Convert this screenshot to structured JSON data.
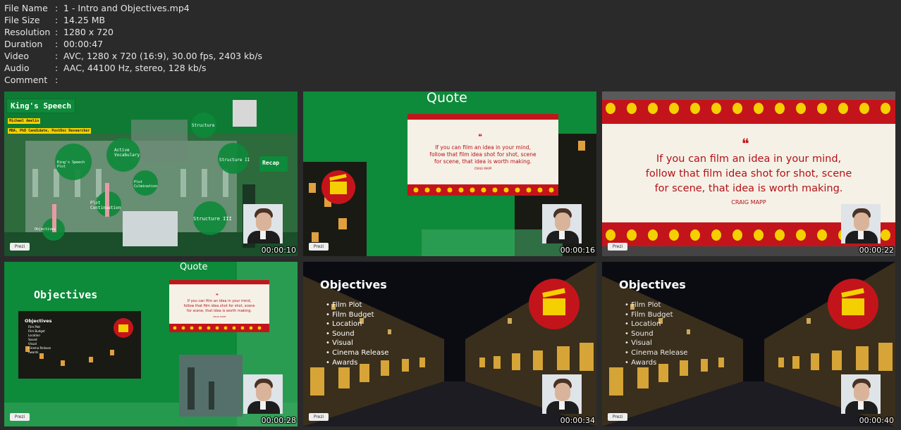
{
  "file_info": [
    {
      "key": "File Name",
      "value": "1 - Intro and Objectives.mp4"
    },
    {
      "key": "File Size",
      "value": "14.25 MB"
    },
    {
      "key": "Resolution",
      "value": "1280 x 720"
    },
    {
      "key": "Duration",
      "value": "00:00:47"
    },
    {
      "key": "Video",
      "value": "AVC, 1280 x 720 (16:9), 30.00 fps, 2403 kb/s"
    },
    {
      "key": "Audio",
      "value": "AAC, 44100 Hz, stereo, 128 kb/s"
    },
    {
      "key": "Comment",
      "value": ""
    }
  ],
  "separator": ":",
  "thumbnails": [
    {
      "timestamp": "00:00:10"
    },
    {
      "timestamp": "00:00:16"
    },
    {
      "timestamp": "00:00:22"
    },
    {
      "timestamp": "00:00:28"
    },
    {
      "timestamp": "00:00:34"
    },
    {
      "timestamp": "00:00:40"
    }
  ],
  "slide1": {
    "title": "King's Speech",
    "author": "Michael Amelin",
    "credentials": "MBA, PhD Candidate, PostDoc Researcher",
    "nodes": [
      "Structure",
      "Active Vocabulary",
      "King's Speech Plot",
      "Structure II",
      "Recap",
      "Plot Culmination",
      "Plot Continuation",
      "Structure III",
      "Objectives"
    ]
  },
  "quote": {
    "heading": "Quote",
    "mark": "❝",
    "line1": "If you can film an idea in your mind,",
    "line2": "follow that film idea shot for shot, scene",
    "line3": "for scene, that idea is worth making.",
    "author": "CRAIG MAPP"
  },
  "objectives": {
    "title": "Objectives",
    "items": [
      "Film Plot",
      "Film Budget",
      "Location",
      "Sound",
      "Visual",
      "Cinema Release",
      "Awards"
    ]
  },
  "prezi_label": "Prezi",
  "colors": {
    "green": "#0d8a3a",
    "red": "#c4141b",
    "yellow": "#f4d000",
    "cream": "#f6f1e6"
  }
}
